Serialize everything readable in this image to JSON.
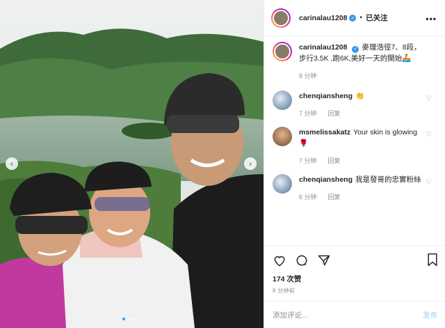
{
  "post": {
    "author": "carinalau1208",
    "follow_status": "已关注",
    "more": "•••",
    "caption": "麥理浩徑7、8段，步行3.5K ,跑6K,美好一天的開始🚣",
    "caption_time": "8 分钟"
  },
  "comments": [
    {
      "user": "chenqiansheng",
      "text": "👏",
      "time": "7 分钟",
      "reply": "回复"
    },
    {
      "user": "msmelissakatz",
      "text": "Your skin is glowing 🌹",
      "time": "7 分钟",
      "reply": "回复"
    },
    {
      "user": "chenqiansheng",
      "text": "我是發哥的忠實粉絲",
      "time": "6 分钟",
      "reply": "回复"
    }
  ],
  "stats": {
    "likes": "174 次赞",
    "time_ago": "8 分钟前"
  },
  "composer": {
    "placeholder": "添加评论...",
    "post_label": "发布"
  },
  "media": {
    "prev_arrow": "‹",
    "next_arrow": "›",
    "slides": 3,
    "active_slide": 1
  },
  "colors": {
    "link_blue": "#3897f0",
    "muted": "#8e8e8e",
    "post_disabled": "#b2dffc"
  },
  "icons": [
    "verified-badge-icon",
    "heart-icon",
    "comment-icon",
    "share-icon",
    "bookmark-icon"
  ]
}
